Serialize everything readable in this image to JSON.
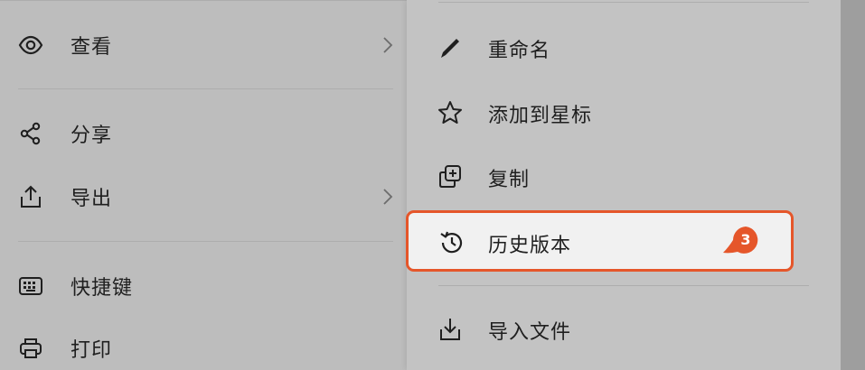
{
  "left_menu": {
    "items": [
      {
        "label": "查看",
        "icon": "eye-icon",
        "has_submenu": true
      },
      {
        "label": "分享",
        "icon": "share-icon",
        "has_submenu": false
      },
      {
        "label": "导出",
        "icon": "export-icon",
        "has_submenu": true
      },
      {
        "label": "快捷键",
        "icon": "keyboard-icon",
        "has_submenu": false
      },
      {
        "label": "打印",
        "icon": "printer-icon",
        "has_submenu": false
      }
    ]
  },
  "right_menu": {
    "items": [
      {
        "label": "重命名",
        "icon": "pencil-icon"
      },
      {
        "label": "添加到星标",
        "icon": "star-icon"
      },
      {
        "label": "复制",
        "icon": "duplicate-icon"
      },
      {
        "label": "历史版本",
        "icon": "history-icon",
        "highlighted": true,
        "badge": "3"
      },
      {
        "label": "导入文件",
        "icon": "import-icon"
      }
    ]
  },
  "colors": {
    "highlight_border": "#e5562a",
    "badge": "#e5562a"
  }
}
